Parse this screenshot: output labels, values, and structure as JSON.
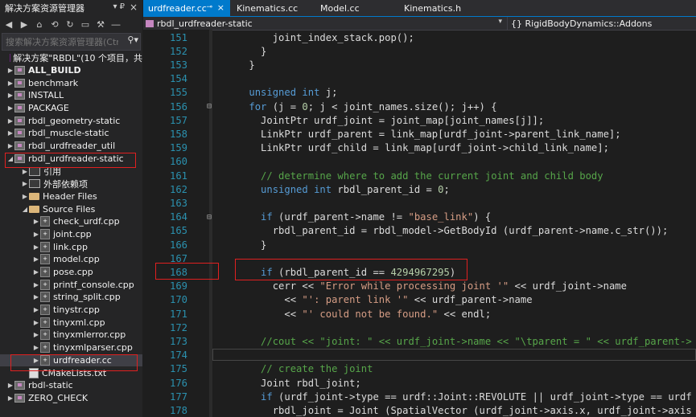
{
  "solution_explorer": {
    "title": "解决方案资源管理器",
    "pin": "▾ ₽",
    "close": "×",
    "toolbar_icons": [
      "back-icon",
      "forward-icon",
      "home-icon",
      "sync-icon",
      "refresh-icon",
      "collapse-icon",
      "properties-icon",
      "more-icon"
    ],
    "search_placeholder": "搜索解决方案资源管理器(Ctrl+;)",
    "solution_label": "解决方案\"RBDL\"(10 个项目，共",
    "items": [
      {
        "label": "ALL_BUILD",
        "bold": true
      },
      {
        "label": "benchmark"
      },
      {
        "label": "INSTALL"
      },
      {
        "label": "PACKAGE"
      },
      {
        "label": "rbdl_geometry-static"
      },
      {
        "label": "rbdl_muscle-static"
      },
      {
        "label": "rbdl_urdfreader_util"
      },
      {
        "label": "rbdl_urdfreader-static"
      },
      {
        "label": "引用"
      },
      {
        "label": "外部依赖项"
      },
      {
        "label": "Header Files"
      },
      {
        "label": "Source Files"
      },
      {
        "label": "check_urdf.cpp"
      },
      {
        "label": "joint.cpp"
      },
      {
        "label": "link.cpp"
      },
      {
        "label": "model.cpp"
      },
      {
        "label": "pose.cpp"
      },
      {
        "label": "printf_console.cpp"
      },
      {
        "label": "string_split.cpp"
      },
      {
        "label": "tinystr.cpp"
      },
      {
        "label": "tinyxml.cpp"
      },
      {
        "label": "tinyxmlerror.cpp"
      },
      {
        "label": "tinyxmlparser.cpp"
      },
      {
        "label": "urdfreader.cc"
      },
      {
        "label": "CMakeLists.txt"
      },
      {
        "label": "rbdl-static"
      },
      {
        "label": "ZERO_CHECK"
      }
    ]
  },
  "editor": {
    "tabs": [
      {
        "label": "urdfreader.cc",
        "active": true,
        "pin": "⊸",
        "close": "×"
      },
      {
        "label": "Kinematics.cc"
      },
      {
        "label": "Model.cc"
      },
      {
        "label": "Kinematics.h"
      }
    ],
    "nav_left": "rbdl_urdfreader-static",
    "nav_right": "{} RigidBodyDynamics::Addons",
    "lines": [
      {
        "n": "151",
        "code": "        joint_index_stack.pop();"
      },
      {
        "n": "152",
        "code": "      }"
      },
      {
        "n": "153",
        "code": "    }"
      },
      {
        "n": "154",
        "code": ""
      },
      {
        "n": "155",
        "code": "    unsigned int j;"
      },
      {
        "n": "156",
        "code": "    for (j = 0; j < joint_names.size(); j++) {"
      },
      {
        "n": "157",
        "code": "      JointPtr urdf_joint = joint_map[joint_names[j]];"
      },
      {
        "n": "158",
        "code": "      LinkPtr urdf_parent = link_map[urdf_joint->parent_link_name];"
      },
      {
        "n": "159",
        "code": "      LinkPtr urdf_child = link_map[urdf_joint->child_link_name];"
      },
      {
        "n": "160",
        "code": ""
      },
      {
        "n": "161",
        "code": "      // determine where to add the current joint and child body"
      },
      {
        "n": "162",
        "code": "      unsigned int rbdl_parent_id = 0;"
      },
      {
        "n": "163",
        "code": ""
      },
      {
        "n": "164",
        "code": "      if (urdf_parent->name != \"base_link\") {"
      },
      {
        "n": "165",
        "code": "        rbdl_parent_id = rbdl_model->GetBodyId (urdf_parent->name.c_str());"
      },
      {
        "n": "166",
        "code": "      }"
      },
      {
        "n": "167",
        "code": ""
      },
      {
        "n": "168",
        "code": "      if (rbdl_parent_id == 4294967295)"
      },
      {
        "n": "169",
        "code": "        cerr << \"Error while processing joint '\" << urdf_joint->name"
      },
      {
        "n": "170",
        "code": "          << \"': parent link '\" << urdf_parent->name"
      },
      {
        "n": "171",
        "code": "          << \"' could not be found.\" << endl;"
      },
      {
        "n": "172",
        "code": ""
      },
      {
        "n": "173",
        "code": "      //cout << \"joint: \" << urdf_joint->name << \"\\tparent = \" << urdf_parent->"
      },
      {
        "n": "174",
        "code": ""
      },
      {
        "n": "175",
        "code": "      // create the joint"
      },
      {
        "n": "176",
        "code": "      Joint rbdl_joint;"
      },
      {
        "n": "177",
        "code": "      if (urdf_joint->type == urdf::Joint::REVOLUTE || urdf_joint->type == urdf"
      },
      {
        "n": "178",
        "code": "        rbdl_joint = Joint (SpatialVector (urdf_joint->axis.x, urdf_joint->axis"
      }
    ]
  },
  "colors": {
    "accent": "#007acc",
    "highlight_box": "#e02020",
    "keyword": "#569cd6",
    "comment": "#57a64a",
    "string": "#d69d85",
    "line_number": "#2b91af"
  }
}
